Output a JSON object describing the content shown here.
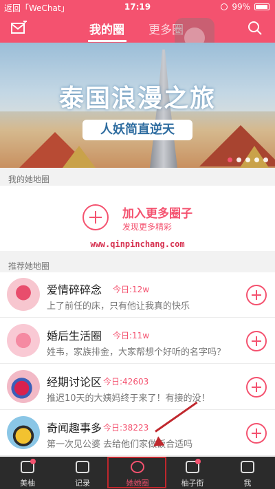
{
  "status_bar": {
    "back": "返回「WeChat」",
    "time": "17:19",
    "battery": "99%"
  },
  "header": {
    "tab_active": "我的圈",
    "tab_inactive": "更多圈",
    "accent": "#f4526f"
  },
  "banner": {
    "title": "泰国浪漫之旅",
    "subtitle": "人妖简直逆天",
    "dots": 5
  },
  "my_circles": {
    "section": "我的她地圈",
    "join_title": "加入更多圈子",
    "join_sub": "发现更多精彩"
  },
  "watermark": "www.qinpinchang.com",
  "recommended": {
    "section": "推荐她地圈",
    "items": [
      {
        "title": "爱情碎碎念",
        "count": "今日:12w",
        "desc": "上了前任的床，只有他让我真的快乐"
      },
      {
        "title": "婚后生活圈",
        "count": "今日:11w",
        "desc": "姓韦，家族排金，大家帮想个好听的名字吗？"
      },
      {
        "title": "经期讨论区",
        "count": "今日:42603",
        "desc": "推迟10天的大姨妈终于来了！有接的没！"
      },
      {
        "title": "奇闻趣事多",
        "count": "今日:38223",
        "desc": "第一次见公婆 去给他们家做饭合适吗"
      }
    ]
  },
  "tabbar": {
    "items": [
      "美柚",
      "记录",
      "她她圈",
      "柚子街",
      "我"
    ],
    "active_index": 2
  }
}
